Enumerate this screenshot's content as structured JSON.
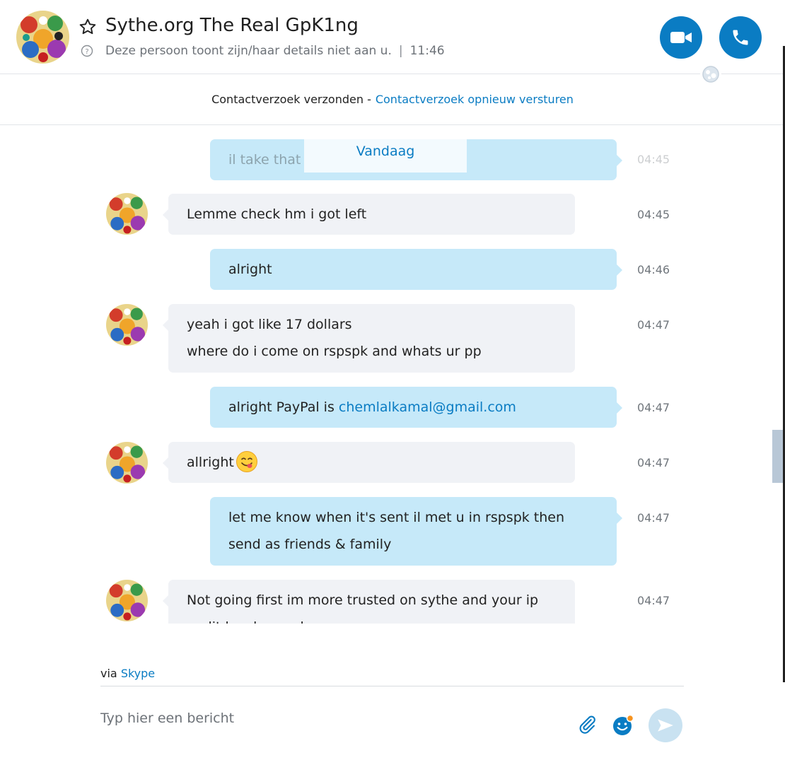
{
  "header": {
    "title": "Sythe.org The Real GpK1ng",
    "subtitle": "Deze persoon toont zijn/haar details niet aan u.",
    "time": "11:46",
    "star_icon": "star-outline-icon",
    "info_icon": "question-circle-icon",
    "video_icon": "video-camera-icon",
    "call_icon": "phone-icon"
  },
  "request": {
    "text": "Contactverzoek verzonden -",
    "link": "Contactverzoek opnieuw versturen"
  },
  "date_divider": "Vandaag",
  "messages": [
    {
      "direction": "out",
      "lines": [
        "il take that"
      ],
      "time": "04:45"
    },
    {
      "direction": "in",
      "lines": [
        "Lemme check hm i got left"
      ],
      "time": "04:45"
    },
    {
      "direction": "out",
      "lines": [
        "alright"
      ],
      "time": "04:46"
    },
    {
      "direction": "in",
      "lines": [
        "yeah i got like 17 dollars",
        "where do i come on rspspk and whats ur pp"
      ],
      "time": "04:47"
    },
    {
      "direction": "out",
      "prefix": "alright PayPal is ",
      "email": "chemlalkamal@gmail.com",
      "time": "04:47"
    },
    {
      "direction": "in",
      "lines": [
        "allright"
      ],
      "emoji": "yum-face-emoji",
      "time": "04:47"
    },
    {
      "direction": "out",
      "lines": [
        "let me know when it's sent il met u in rspspk then",
        "send as friends & family"
      ],
      "time": "04:47"
    },
    {
      "direction": "in",
      "lines": [
        "Not going first im more trusted on sythe and your ip",
        "audit has banned users sorry"
      ],
      "time": "04:47"
    }
  ],
  "footer": {
    "via_text": "via",
    "via_link": "Skype",
    "placeholder": "Typ hier een bericht"
  },
  "colors": {
    "accent": "#0a7cc3",
    "incoming_bubble": "#f0f2f6",
    "outgoing_bubble": "#c6e9f9"
  }
}
